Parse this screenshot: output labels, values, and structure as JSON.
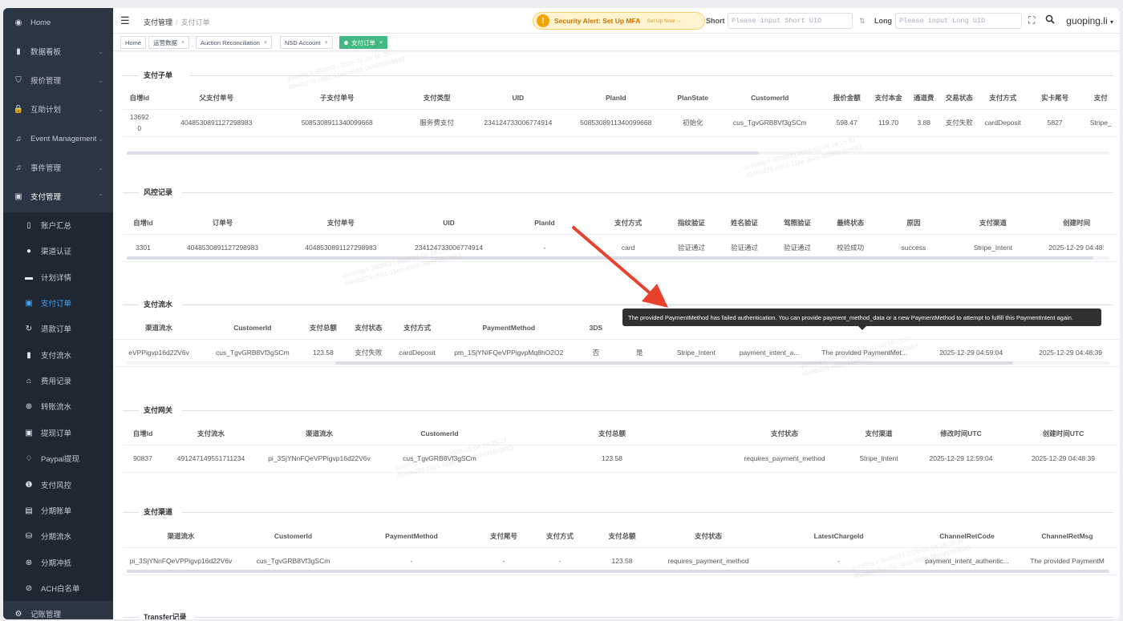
{
  "sidebar": {
    "items": [
      {
        "label": "Home",
        "icon": "dashboard-icon",
        "chevron": false
      },
      {
        "label": "数据看板",
        "icon": "bar-chart-icon",
        "chevron": true
      },
      {
        "label": "报价管理",
        "icon": "shopping-bag-icon",
        "chevron": true
      },
      {
        "label": "互助计划",
        "icon": "lock-icon",
        "chevron": true
      },
      {
        "label": "Event Management",
        "icon": "headset-icon",
        "chevron": true
      },
      {
        "label": "事件管理",
        "icon": "headset-icon",
        "chevron": true
      },
      {
        "label": "支付管理",
        "icon": "payment-icon",
        "chevron": true
      }
    ],
    "sub_items": [
      {
        "label": "账户汇总",
        "icon": "phone-icon"
      },
      {
        "label": "渠道认证",
        "icon": "user-icon"
      },
      {
        "label": "计划详情",
        "icon": "monitor-icon"
      },
      {
        "label": "支付订单",
        "icon": "payment-icon"
      },
      {
        "label": "退款订单",
        "icon": "refresh-icon"
      },
      {
        "label": "支付流水",
        "icon": "bar-chart-icon"
      },
      {
        "label": "费用记录",
        "icon": "home-icon"
      },
      {
        "label": "转账流水",
        "icon": "plus-circle-icon"
      },
      {
        "label": "提现订单",
        "icon": "payment-icon"
      },
      {
        "label": "Paypal提现",
        "icon": "bell-icon"
      },
      {
        "label": "支付风控",
        "icon": "info-icon"
      },
      {
        "label": "分期账单",
        "icon": "document-icon"
      },
      {
        "label": "分期流水",
        "icon": "database-icon"
      },
      {
        "label": "分期冲抵",
        "icon": "globe-icon"
      },
      {
        "label": "ACH白名单",
        "icon": "link-icon"
      }
    ],
    "bottom_item": {
      "label": "记账管理",
      "icon": "gear-icon"
    }
  },
  "header": {
    "breadcrumb": [
      "支付管理",
      "支付订单"
    ],
    "alert_title": "Security Alert: Set Up MFA",
    "alert_action": "Set Up Now →",
    "short_label": "Short",
    "short_placeholder": "Please input Short UID",
    "long_label": "Long",
    "long_placeholder": "Please input Long UID",
    "user": "guoping.li"
  },
  "tags": [
    {
      "label": "Home",
      "closable": false
    },
    {
      "label": "运营数据",
      "closable": true
    },
    {
      "label": "Auction Reconciliation",
      "closable": true
    },
    {
      "label": "NSD Account",
      "closable": true
    },
    {
      "label": "支付订单",
      "closable": true,
      "active": true
    }
  ],
  "sections": {
    "sub_orders": {
      "title": "支付子单",
      "headers": [
        "自增Id",
        "父支付单号",
        "子支付单号",
        "支付类型",
        "UID",
        "PlanId",
        "PlanState",
        "CustomerId",
        "报价金额",
        "支付本金",
        "通道费",
        "交易状态",
        "支付方式",
        "实卡尾号",
        "支付"
      ],
      "rows": [
        [
          "13692\n0",
          "4048530891127298983",
          "5085308911340099668",
          "服务费支付",
          "234124733006774914",
          "5085308911340099668",
          "初始化",
          "cus_TgvGRB8Vf3gSCm",
          "598.47",
          "119.70",
          "3.88",
          "支付失败",
          "cardDeposit",
          "5827",
          "Stripe_"
        ]
      ]
    },
    "risk": {
      "title": "风控记录",
      "headers": [
        "自增Id",
        "订单号",
        "支付单号",
        "UID",
        "PlanId",
        "支付方式",
        "指纹验证",
        "姓名验证",
        "驾照验证",
        "最终状态",
        "原因",
        "支付渠道",
        "创建时间"
      ],
      "rows": [
        [
          "3301",
          "4048530891127298983",
          "4048530891127298983",
          "234124733006774914",
          "-",
          "card",
          "验证通过",
          "验证通过",
          "验证通过",
          "校验成功",
          "success",
          "Stripe_Intent",
          "2025-12-29 04:48:"
        ]
      ]
    },
    "flow": {
      "title": "支付流水",
      "headers": [
        "渠道流水",
        "CustomerId",
        "支付总额",
        "支付状态",
        "支付方式",
        "PaymentMethod",
        "3DS",
        "",
        "",
        "",
        "",
        "",
        ""
      ],
      "rows": [
        [
          "eVPPigvp16d22V6v",
          "cus_TgvGRB8Vf3gSCm",
          "123.58",
          "支付失败",
          "cardDeposit",
          "pm_1SjYNIFQeVPPigvpMq8hO2O2",
          "否",
          "是",
          "Stripe_Intent",
          "payment_intent_a...",
          "The provided PaymentMet...",
          "2025-12-29 04:59:04",
          "2025-12-29 04:48:39"
        ]
      ]
    },
    "gateway": {
      "title": "支付网关",
      "headers": [
        "自增Id",
        "支付流水",
        "渠道流水",
        "CustomerId",
        "支付总额",
        "支付状态",
        "支付渠道",
        "修改时间UTC",
        "创建时间UTC"
      ],
      "rows": [
        [
          "90837",
          "491247149551711234",
          "pi_3SjYNnFQeVPPigvp16d22V6v",
          "cus_TgvGRB8Vf3gSCm",
          "123.58",
          "requires_payment_method",
          "Stripe_Intent",
          "2025-12-29 12:59:04",
          "2025-12-29 04:48:39"
        ]
      ]
    },
    "channel": {
      "title": "支付渠道",
      "headers": [
        "渠道流水",
        "CustomerId",
        "PaymentMethod",
        "支付尾号",
        "支付方式",
        "支付总额",
        "支付状态",
        "LatestChargeId",
        "ChannelRetCode",
        "ChannelRetMsg"
      ],
      "rows": [
        [
          "pi_3SjYNnFQeVPPigvp16d22V6v",
          "cus_TgvGRB8Vf3gSCm",
          "-",
          "-",
          "-",
          "123.58",
          "requires_payment_method",
          "-",
          "payment_intent_authentic...",
          "The provided PaymentM"
        ]
      ]
    },
    "transfer": {
      "title": "Transfer记录"
    }
  },
  "tooltip": "The provided PaymentMethod has failed authentication. You can provide payment_method_data or a new PaymentMethod to attempt to fulfill this PaymentIntent again.",
  "watermark": [
    "guoping.li 380883 | 2026-01-04 18:25:37",
    "45e6b279-c661-11ee-9569-06b6f1869683"
  ],
  "colors": {
    "sidebar_bg": "#2b3543",
    "active_link": "#4aa3ff",
    "active_tag": "#42b983",
    "alert_bg": "#fff4cf",
    "annotation_arrow": "#e8412c",
    "tooltip_bg": "#303133"
  }
}
